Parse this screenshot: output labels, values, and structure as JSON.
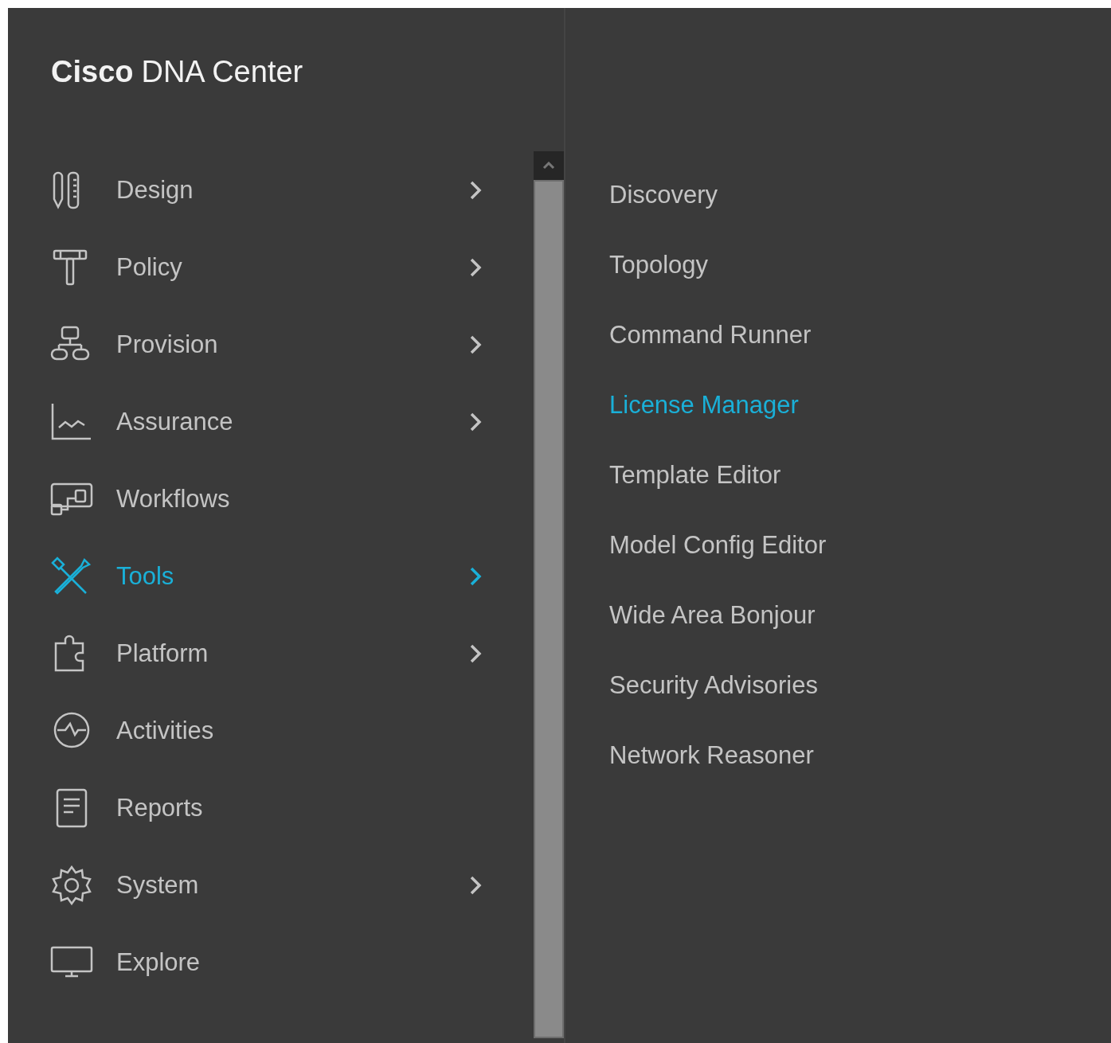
{
  "brand": {
    "name": "Cisco",
    "product": "DNA Center"
  },
  "menu": [
    {
      "label": "Design",
      "has_submenu": true,
      "selected": false
    },
    {
      "label": "Policy",
      "has_submenu": true,
      "selected": false
    },
    {
      "label": "Provision",
      "has_submenu": true,
      "selected": false
    },
    {
      "label": "Assurance",
      "has_submenu": true,
      "selected": false
    },
    {
      "label": "Workflows",
      "has_submenu": false,
      "selected": false
    },
    {
      "label": "Tools",
      "has_submenu": true,
      "selected": true
    },
    {
      "label": "Platform",
      "has_submenu": true,
      "selected": false
    },
    {
      "label": "Activities",
      "has_submenu": false,
      "selected": false
    },
    {
      "label": "Reports",
      "has_submenu": false,
      "selected": false
    },
    {
      "label": "System",
      "has_submenu": true,
      "selected": false
    },
    {
      "label": "Explore",
      "has_submenu": false,
      "selected": false
    }
  ],
  "submenu": [
    {
      "label": "Discovery",
      "selected": false
    },
    {
      "label": "Topology",
      "selected": false
    },
    {
      "label": "Command Runner",
      "selected": false
    },
    {
      "label": "License Manager",
      "selected": true
    },
    {
      "label": "Template Editor",
      "selected": false
    },
    {
      "label": "Model Config Editor",
      "selected": false
    },
    {
      "label": "Wide Area Bonjour",
      "selected": false
    },
    {
      "label": "Security Advisories",
      "selected": false
    },
    {
      "label": "Network Reasoner",
      "selected": false
    }
  ]
}
